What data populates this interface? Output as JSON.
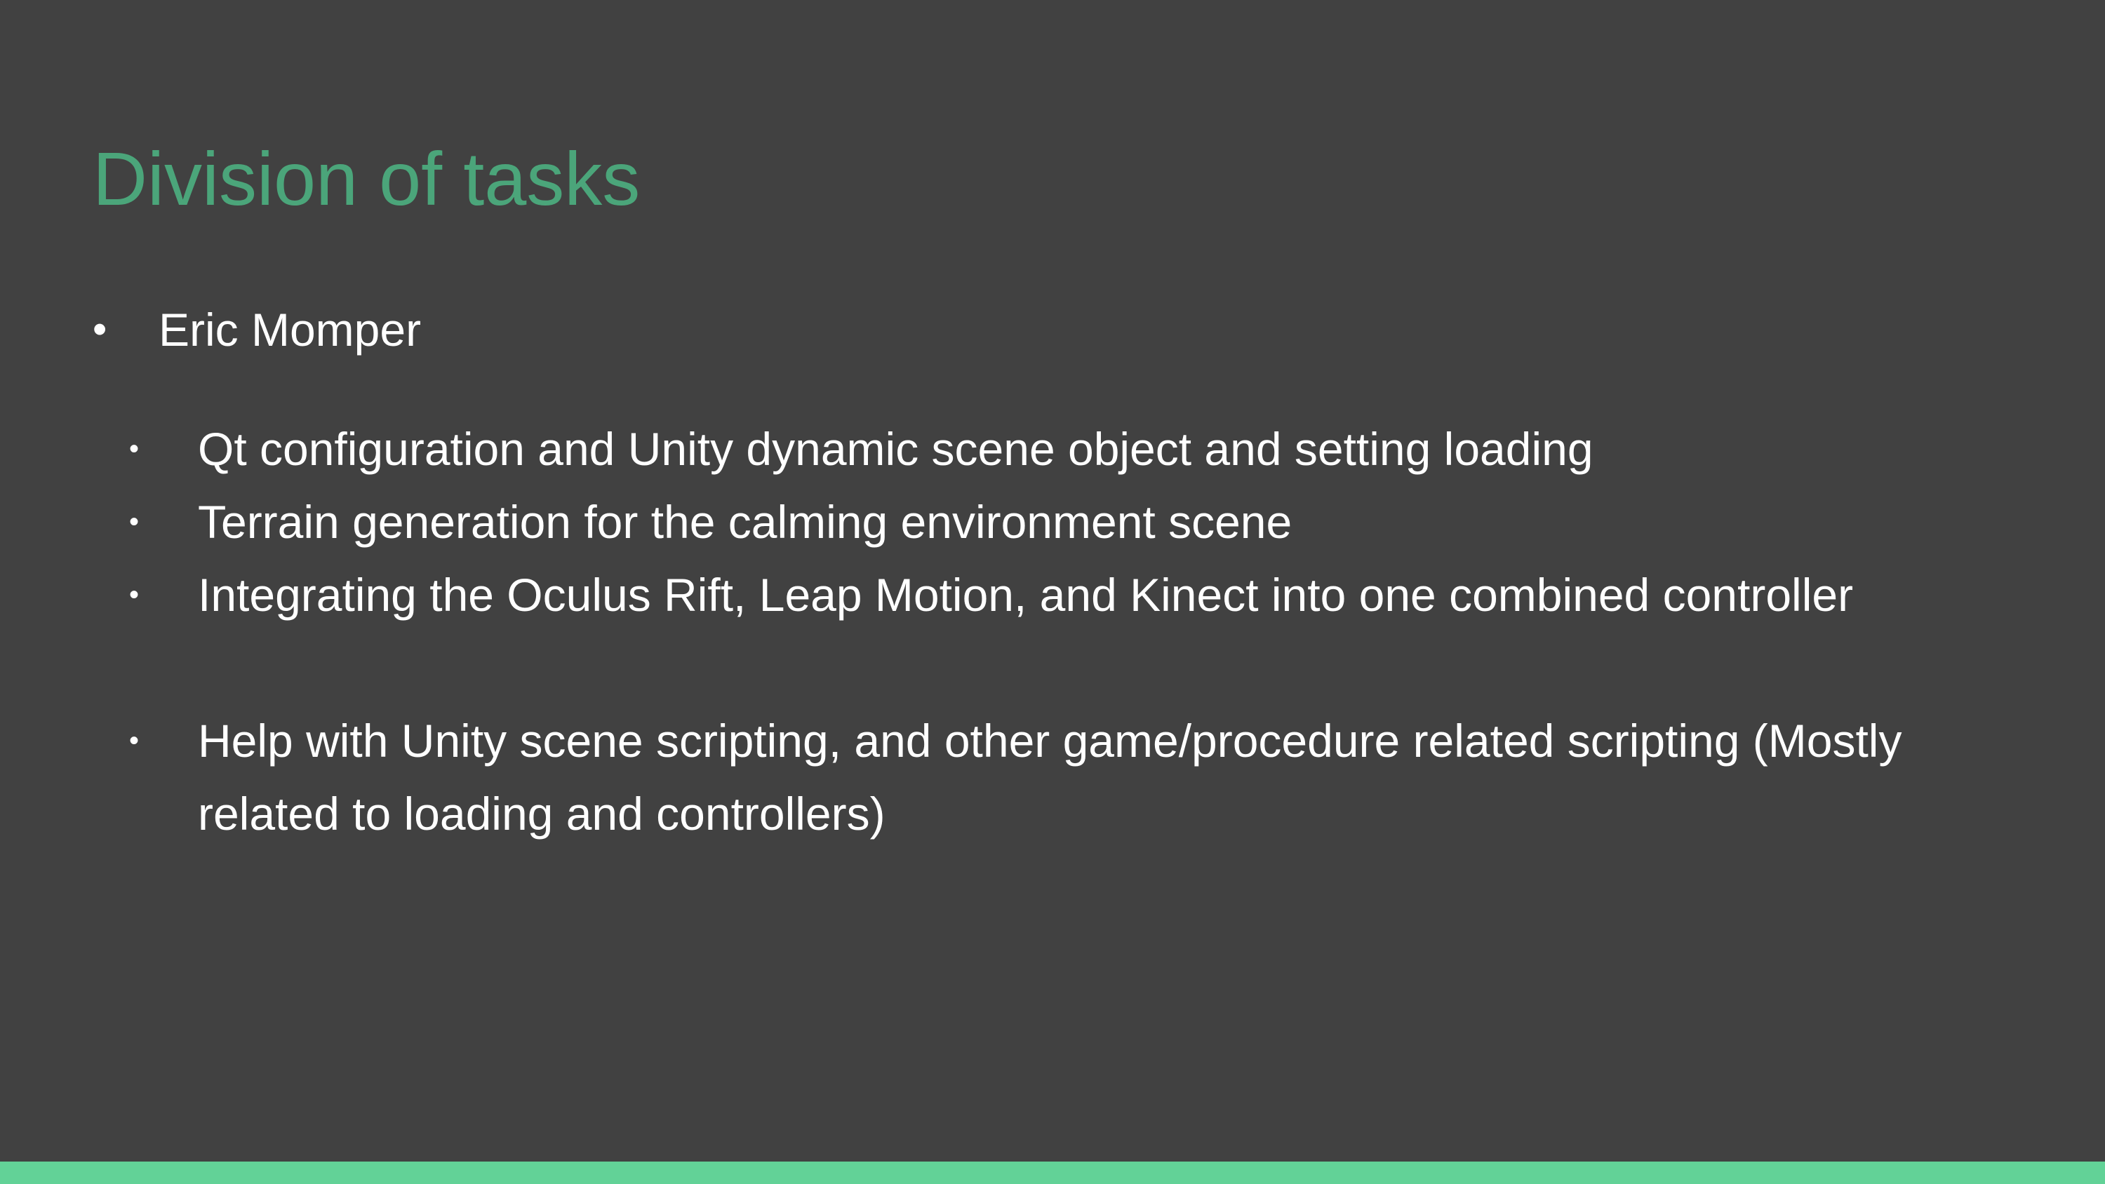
{
  "slide": {
    "title": "Division of tasks",
    "bullet_char": "•",
    "accent_color": "#4ba57a",
    "bar_color": "#62d297",
    "background_color": "#414141",
    "person": "Eric Momper",
    "tasks": [
      "Qt configuration and Unity dynamic scene object and setting loading",
      "Terrain generation for the calming environment scene",
      "Integrating the Oculus Rift, Leap Motion, and Kinect into one combined controller",
      "Help with Unity scene scripting, and other game/procedure related scripting (Mostly related to loading and controllers)"
    ]
  }
}
